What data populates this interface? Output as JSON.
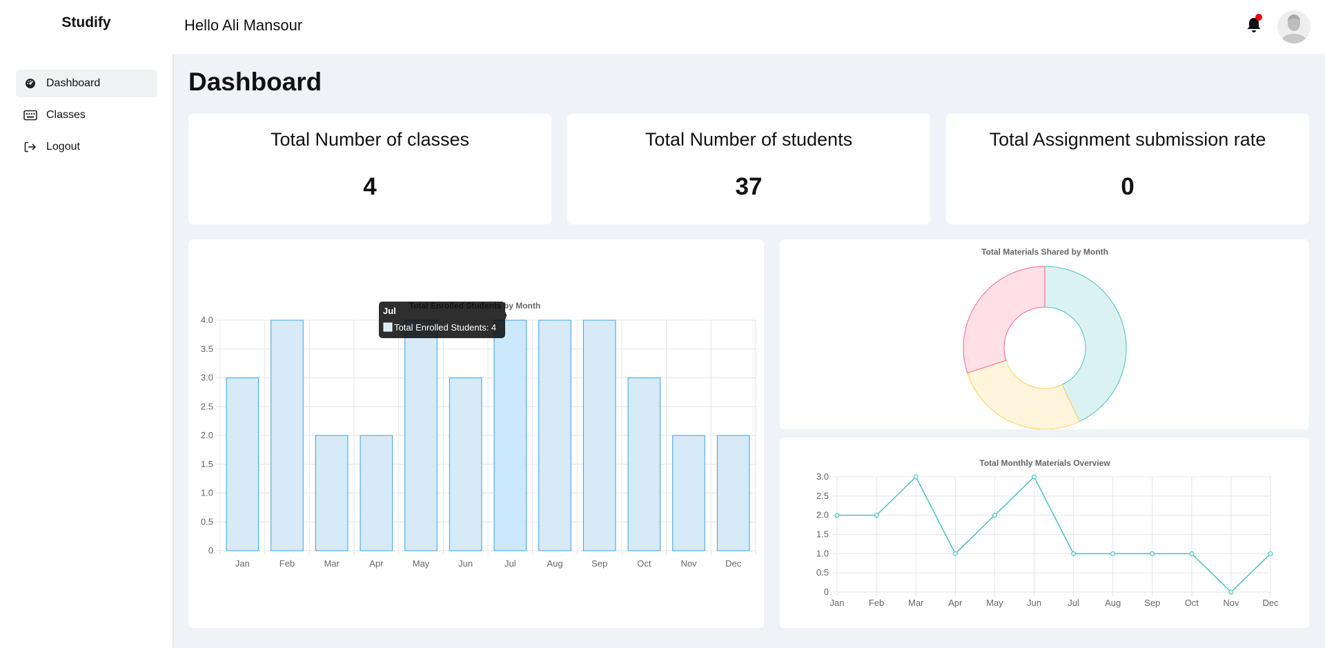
{
  "app": {
    "brand": "Studify"
  },
  "sidebar": {
    "items": [
      {
        "label": "Dashboard",
        "icon": "dashboard-icon",
        "active": true
      },
      {
        "label": "Classes",
        "icon": "keyboard-icon",
        "active": false
      },
      {
        "label": "Logout",
        "icon": "logout-icon",
        "active": false
      }
    ]
  },
  "header": {
    "greeting": "Hello Ali Mansour",
    "notification_icon": "bell-icon",
    "notification_badge_color": "#e8000b"
  },
  "page": {
    "title": "Dashboard"
  },
  "stats": [
    {
      "title": "Total Number of classes",
      "value": "4"
    },
    {
      "title": "Total Number of students",
      "value": "37"
    },
    {
      "title": "Total Assignment submission rate",
      "value": "0"
    }
  ],
  "chart_data": [
    {
      "type": "bar",
      "title": "Total Enrolled Students by Month",
      "categories": [
        "Jan",
        "Feb",
        "Mar",
        "Apr",
        "May",
        "Jun",
        "Jul",
        "Aug",
        "Sep",
        "Oct",
        "Nov",
        "Dec"
      ],
      "series": [
        {
          "name": "Total Enrolled Students",
          "values": [
            3,
            4,
            2,
            2,
            4,
            3,
            4,
            4,
            4,
            3,
            2,
            2
          ]
        }
      ],
      "ylim": [
        0,
        4
      ],
      "yticks": [
        "0",
        "0.5",
        "1.0",
        "1.5",
        "2.0",
        "2.5",
        "3.0",
        "3.5",
        "4.0"
      ],
      "grid": true,
      "colors": {
        "fill": "#d6eaf8",
        "border": "#36a2eb",
        "hover_fill": "#cce8fb"
      },
      "tooltip": {
        "category": "Jul",
        "label": "Total Enrolled Students: 4"
      }
    },
    {
      "type": "pie",
      "title": "Total Materials Shared by Month",
      "slices": [
        {
          "value": 43,
          "color": "#4bc0c0",
          "fill": "#dbf2f2"
        },
        {
          "value": 27,
          "color": "#ffcd56",
          "fill": "#fff5dd"
        },
        {
          "value": 30,
          "color": "#ff6384",
          "fill": "#ffe0e6"
        }
      ]
    },
    {
      "type": "line",
      "title": "Total Monthly Materials Overview",
      "categories": [
        "Jan",
        "Feb",
        "Mar",
        "Apr",
        "May",
        "Jun",
        "Jul",
        "Aug",
        "Sep",
        "Oct",
        "Nov",
        "Dec"
      ],
      "values": [
        2,
        2,
        3,
        1,
        2,
        3,
        1,
        1,
        1,
        1,
        0,
        1
      ],
      "ylim": [
        0,
        3
      ],
      "yticks": [
        "0",
        "0.5",
        "1.0",
        "1.5",
        "2.0",
        "2.5",
        "3.0"
      ],
      "grid": true,
      "colors": {
        "line": "#4bc0c0"
      }
    }
  ]
}
